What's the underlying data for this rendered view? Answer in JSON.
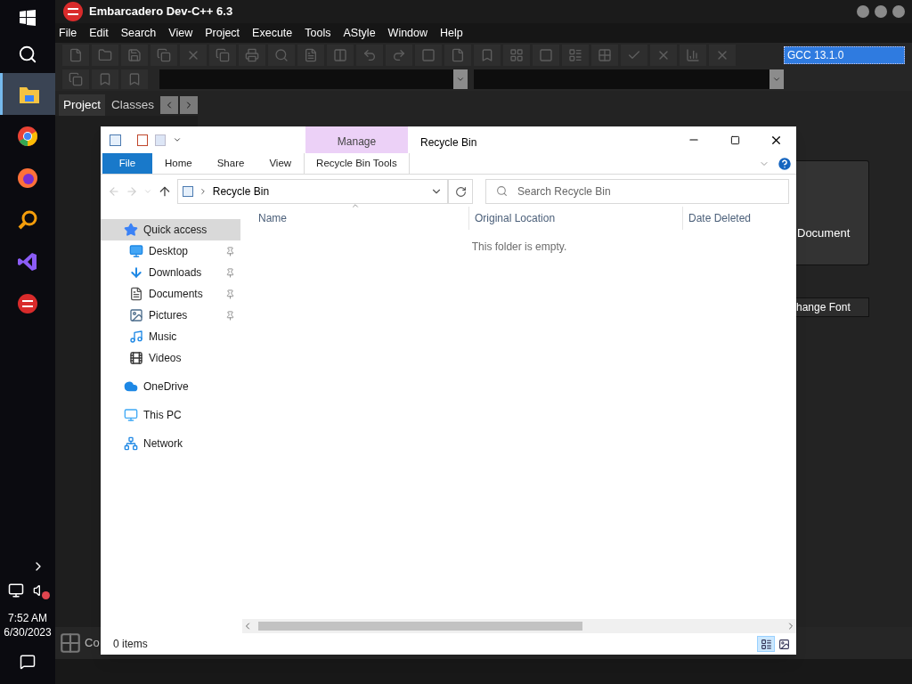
{
  "taskbar": {
    "apps": [
      {
        "kind": "folder",
        "selected": true
      },
      {
        "kind": "chrome",
        "selected": false
      },
      {
        "kind": "firefox",
        "selected": false
      },
      {
        "kind": "magnifier",
        "selected": false
      },
      {
        "kind": "studio",
        "selected": false
      },
      {
        "kind": "devcpp",
        "selected": false
      }
    ],
    "time": "7:52 AM",
    "date": "6/30/2023",
    "muted": true
  },
  "devcpp": {
    "title": "Embarcadero Dev-C++ 6.3",
    "menu": [
      "File",
      "Edit",
      "Search",
      "View",
      "Project",
      "Execute",
      "Tools",
      "AStyle",
      "Window",
      "Help"
    ],
    "compiler": "GCC 13.1.0",
    "panel_tabs": [
      {
        "label": "Project",
        "selected": true
      },
      {
        "label": "Classes",
        "selected": false
      }
    ],
    "tile_label": "Document",
    "font_button": "hange Font",
    "bottom_label": "Co"
  },
  "explorer": {
    "context_group": "Manage",
    "title": "Recycle Bin",
    "ribbon_tabs": [
      {
        "label": "File",
        "kind": "file"
      },
      {
        "label": "Home",
        "kind": "tab"
      },
      {
        "label": "Share",
        "kind": "tab"
      },
      {
        "label": "View",
        "kind": "tab"
      },
      {
        "label": "Recycle Bin Tools",
        "kind": "context"
      }
    ],
    "address": "Recycle Bin",
    "search": {
      "placeholder": "Search Recycle Bin"
    },
    "nav": [
      {
        "label": "Quick access",
        "kind": "star",
        "selected": true,
        "children": [
          {
            "label": "Desktop",
            "kind": "desktop",
            "pinned": true
          },
          {
            "label": "Downloads",
            "kind": "download",
            "pinned": true
          },
          {
            "label": "Documents",
            "kind": "document",
            "pinned": true
          },
          {
            "label": "Pictures",
            "kind": "picture",
            "pinned": true
          },
          {
            "label": "Music",
            "kind": "music",
            "pinned": false
          },
          {
            "label": "Videos",
            "kind": "video",
            "pinned": false
          }
        ]
      },
      {
        "label": "OneDrive",
        "kind": "cloud",
        "selected": false
      },
      {
        "label": "This PC",
        "kind": "pc",
        "selected": false
      },
      {
        "label": "Network",
        "kind": "network",
        "selected": false
      }
    ],
    "columns": [
      {
        "label": "Name",
        "sorted": true
      },
      {
        "label": "Original Location",
        "sorted": false
      },
      {
        "label": "Date Deleted",
        "sorted": false
      }
    ],
    "empty_message": "This folder is empty.",
    "status": "0 items",
    "views": [
      {
        "kind": "details",
        "selected": true
      },
      {
        "kind": "large",
        "selected": false
      }
    ]
  }
}
